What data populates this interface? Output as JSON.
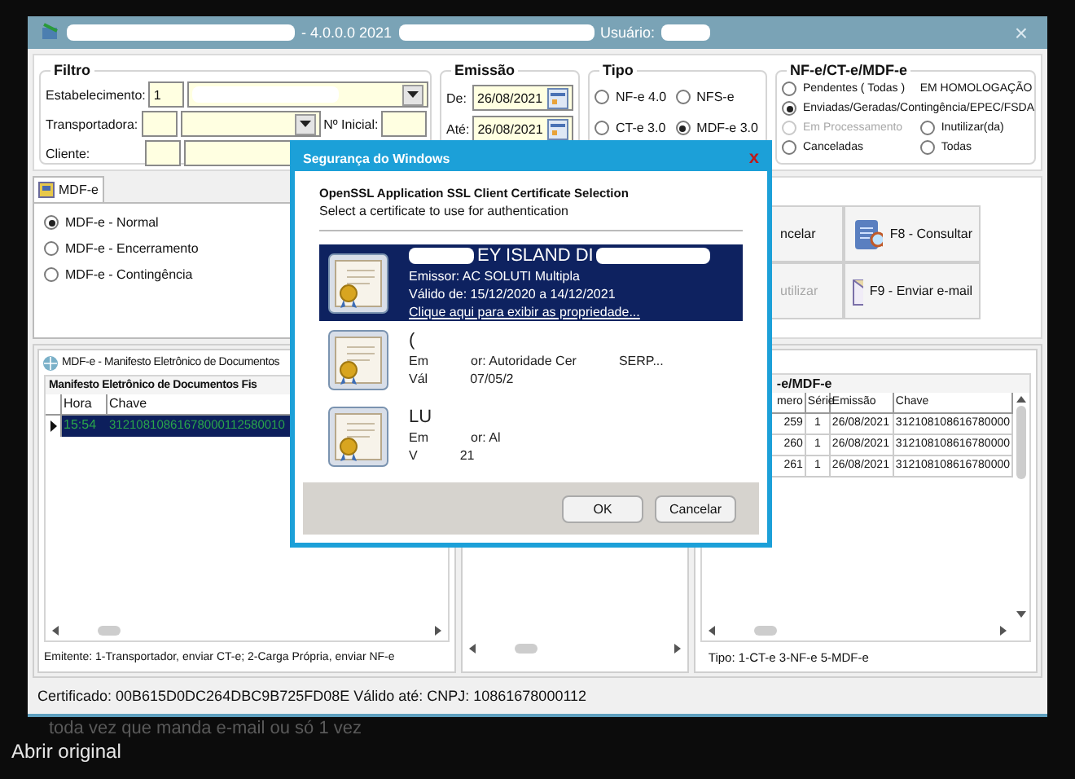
{
  "window": {
    "title_parts": [
      "- 4.0.0.0 2021",
      "Usuário:"
    ],
    "close": "×"
  },
  "filter": {
    "title": "Filtro",
    "estabelecimento": {
      "label": "Estabelecimento:",
      "code": "1"
    },
    "transportadora": {
      "label": "Transportadora:"
    },
    "numero_inicial": {
      "label": "Nº Inicial:"
    },
    "cliente": {
      "label": "Cliente:"
    }
  },
  "emissao": {
    "title": "Emissão",
    "from": {
      "label": "De:",
      "value": "26/08/2021"
    },
    "to": {
      "label": "Até:",
      "value": "26/08/2021"
    }
  },
  "tipo": {
    "title": "Tipo",
    "options": [
      {
        "label": "NF-e 4.0",
        "selected": false
      },
      {
        "label": "NFS-e",
        "selected": false
      },
      {
        "label": "CT-e 3.0",
        "selected": false
      },
      {
        "label": "MDF-e 3.0",
        "selected": true
      }
    ]
  },
  "status_group": {
    "title": "NF-e/CT-e/MDF-e",
    "note": "EM HOMOLOGAÇÃO",
    "options": [
      {
        "label": "Pendentes ( Todas )",
        "selected": false,
        "disabled": false
      },
      {
        "label": "Enviadas/Geradas/Contingência/EPEC/FSDA",
        "selected": true,
        "disabled": false
      },
      {
        "label": "Em Processamento",
        "selected": false,
        "disabled": true
      },
      {
        "label": "Inutilizar(da)",
        "selected": false,
        "disabled": false
      },
      {
        "label": "Canceladas",
        "selected": false,
        "disabled": false
      },
      {
        "label": "Todas",
        "selected": false,
        "disabled": false
      }
    ]
  },
  "tab": {
    "label": "MDF-e",
    "selected": true,
    "options": [
      {
        "label": "MDF-e - Normal",
        "selected": true
      },
      {
        "label": "MDF-e - Encerramento",
        "selected": false
      },
      {
        "label": "MDF-e - Contingência",
        "selected": false
      }
    ]
  },
  "actions": [
    {
      "label": "ncelar",
      "kind": "plain",
      "disabled": false
    },
    {
      "label": "F8 - Consultar",
      "kind": "search",
      "disabled": false
    },
    {
      "label": "utilizar",
      "kind": "plain",
      "disabled": true
    },
    {
      "label": "F9 - Enviar e-mail",
      "kind": "mail",
      "disabled": false
    }
  ],
  "left_panel": {
    "title": "MDF-e - Manifesto Eletrônico de Documentos",
    "group": "Manifesto Eletrônico de Documentos Fis",
    "columns": [
      "Hora",
      "Chave"
    ],
    "rows": [
      {
        "cells": [
          "15:54",
          "31210810861678000112580010"
        ],
        "selected": true
      }
    ],
    "footer": "Emitente: 1-Transportador, enviar CT-e;  2-Carga Própria, enviar NF-e"
  },
  "right_panel": {
    "group": "-e/MDF-e",
    "columns": [
      "mero",
      "Série",
      "Emissão",
      "Chave"
    ],
    "rows": [
      {
        "cells": [
          "259",
          "1",
          "26/08/2021",
          "312108108616780000"
        ],
        "selected": false
      },
      {
        "cells": [
          "260",
          "1",
          "26/08/2021",
          "312108108616780000"
        ],
        "selected": false
      },
      {
        "cells": [
          "261",
          "1",
          "26/08/2021",
          "312108108616780000"
        ],
        "selected": false
      }
    ],
    "footer": "Tipo: 1-CT-e   3-NF-e  5-MDF-e"
  },
  "status_bar": "Certificado: 00B615D0DC264DBC9B725FD08E Válido até:  CNPJ: 10861678000112",
  "dialog": {
    "title": "Segurança do Windows",
    "close": "x",
    "heading": "OpenSSL Application SSL Client Certificate Selection",
    "subtitle": "Select a certificate to use for authentication",
    "certificates": [
      {
        "name": [
          "EY ISLAND DI"
        ],
        "issuer": [
          "Emissor: AC SOLUTI Multipla"
        ],
        "validity": [
          "Válido de: 15/12/2020 a 14/12/2021"
        ],
        "link": "Clique aqui para exibir as propriedade...",
        "selected": true
      },
      {
        "name": [
          "("
        ],
        "issuer": [
          "Em",
          "or: Autoridade Cer",
          "SERP..."
        ],
        "validity": [
          "Vál",
          "07/05/2"
        ],
        "selected": false
      },
      {
        "name": [
          "LU"
        ],
        "issuer": [
          "Em",
          "or: Al"
        ],
        "validity": [
          "V",
          "21"
        ],
        "selected": false
      }
    ],
    "buttons": [
      "OK",
      "Cancelar"
    ]
  },
  "caption": "toda vez que manda e-mail ou só 1 vez",
  "open_original": "Abrir original"
}
